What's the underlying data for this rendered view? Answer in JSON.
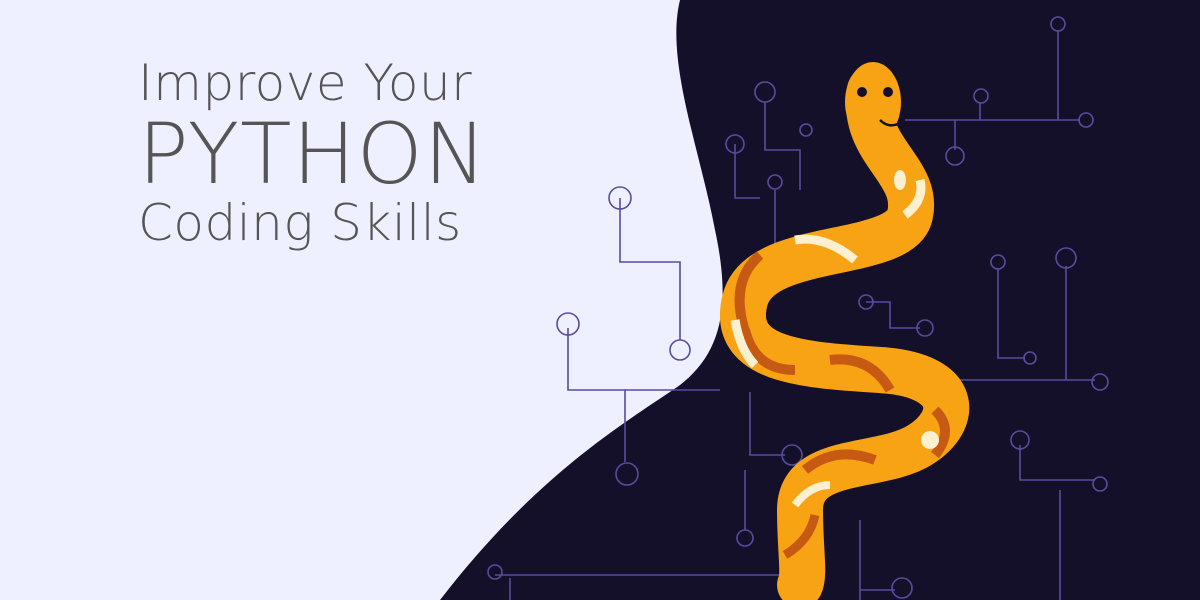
{
  "headline": {
    "line1": "Improve Your",
    "line2": "PYTHON",
    "line3": "Coding Skills"
  },
  "colors": {
    "background_light": "#eef0ff",
    "background_dark": "#15102a",
    "circuit_line": "#5a4b9c",
    "text": "#555555",
    "snake_body": "#f7a314",
    "snake_ring": "#c75a13",
    "snake_spot": "#fdf0d0"
  },
  "icons": [
    "python-snake-illustration",
    "circuit-board-pattern"
  ]
}
